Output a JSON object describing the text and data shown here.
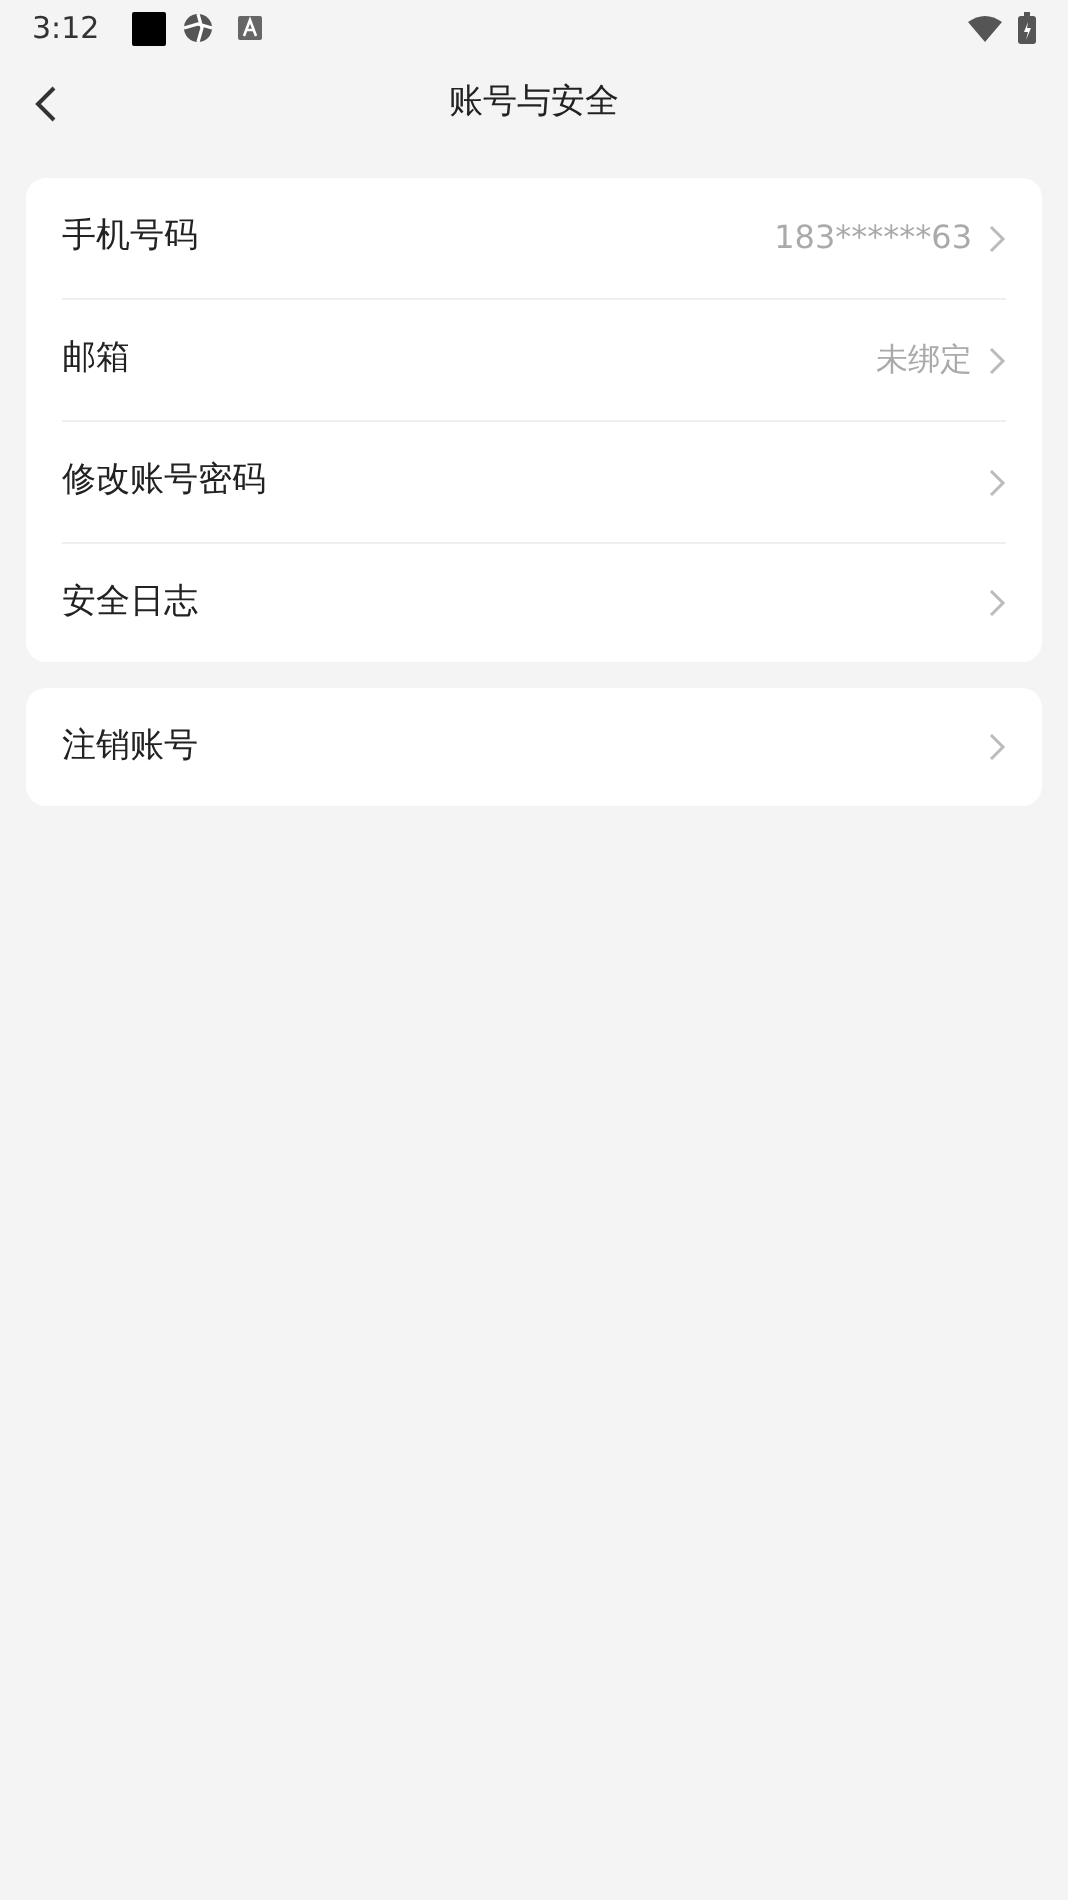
{
  "status_bar": {
    "time": "3:12"
  },
  "header": {
    "title": "账号与安全"
  },
  "groups": [
    {
      "items": [
        {
          "label": "手机号码",
          "value": "183******63"
        },
        {
          "label": "邮箱",
          "value": "未绑定"
        },
        {
          "label": "修改账号密码"
        },
        {
          "label": "安全日志"
        }
      ]
    },
    {
      "items": [
        {
          "label": "注销账号"
        }
      ]
    }
  ]
}
